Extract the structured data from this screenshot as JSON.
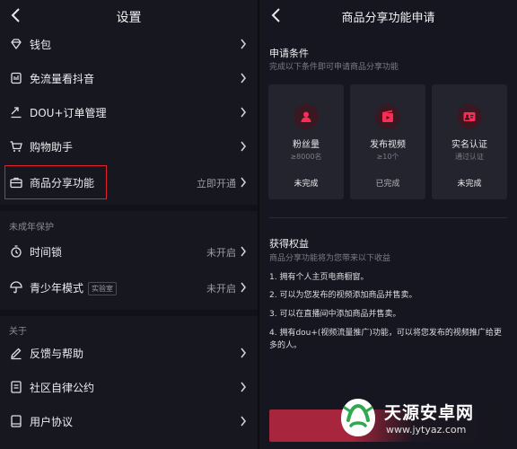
{
  "settings": {
    "title": "设置",
    "items": [
      {
        "label": "钱包",
        "value": ""
      },
      {
        "label": "免流量看抖音",
        "value": ""
      },
      {
        "label": "DOU+订单管理",
        "value": ""
      },
      {
        "label": "购物助手",
        "value": ""
      },
      {
        "label": "商品分享功能",
        "value": "立即开通"
      }
    ],
    "minor_section": "未成年保护",
    "minor_items": [
      {
        "label": "时间锁",
        "value": "未开启"
      },
      {
        "label": "青少年模式",
        "tag": "实验室",
        "value": "未开启"
      }
    ],
    "about_section": "关于",
    "about_items": [
      {
        "label": "反馈与帮助"
      },
      {
        "label": "社区自律公约"
      },
      {
        "label": "用户协议"
      }
    ]
  },
  "apply": {
    "title": "商品分享功能申请",
    "conditions_title": "申请条件",
    "conditions_sub": "完成以下条件即可申请商品分享功能",
    "cards": [
      {
        "name": "粉丝量",
        "req": "≥8000名",
        "status": "未完成"
      },
      {
        "name": "发布视频",
        "req": "≥10个",
        "status": "已完成"
      },
      {
        "name": "实名认证",
        "req": "通过认证",
        "status": "未完成"
      }
    ],
    "benefits_title": "获得权益",
    "benefits_sub": "商品分享功能将为您带来以下收益",
    "benefits": [
      "1. 拥有个人主页电商橱窗。",
      "2. 可以为您发布的视频添加商品并售卖。",
      "3. 可以在直播间中添加商品并售卖。",
      "4. 拥有dou+(视频流量推广)功能，可以将您发布的视频推广给更多的人。"
    ]
  },
  "watermark": {
    "name": "天源安卓网",
    "url": "www.jytyaz.com"
  },
  "colors": {
    "accent": "#e5202b",
    "button": "#a8263d",
    "badge_icon": "#fe2c55"
  }
}
